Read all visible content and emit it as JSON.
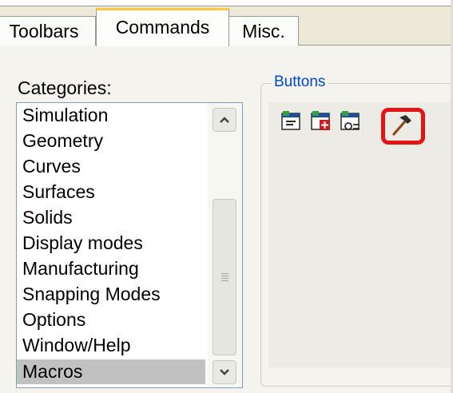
{
  "tabs": [
    {
      "label": "Toolbars"
    },
    {
      "label": "Commands"
    },
    {
      "label": "Misc."
    }
  ],
  "categories": {
    "label": "Categories:",
    "items": [
      "Simulation",
      "Geometry",
      "Curves",
      "Surfaces",
      "Solids",
      "Display modes",
      "Manufacturing",
      "Snapping Modes",
      "Options",
      "Window/Help",
      "Macros"
    ],
    "selected": "Macros"
  },
  "buttons": {
    "label": "Buttons",
    "icons": [
      "macro-editor-icon",
      "new-macro-icon",
      "macro-options-icon",
      "hammer-icon"
    ],
    "highlighted_icon": "hammer-icon",
    "highlight_color": "#e41414"
  }
}
